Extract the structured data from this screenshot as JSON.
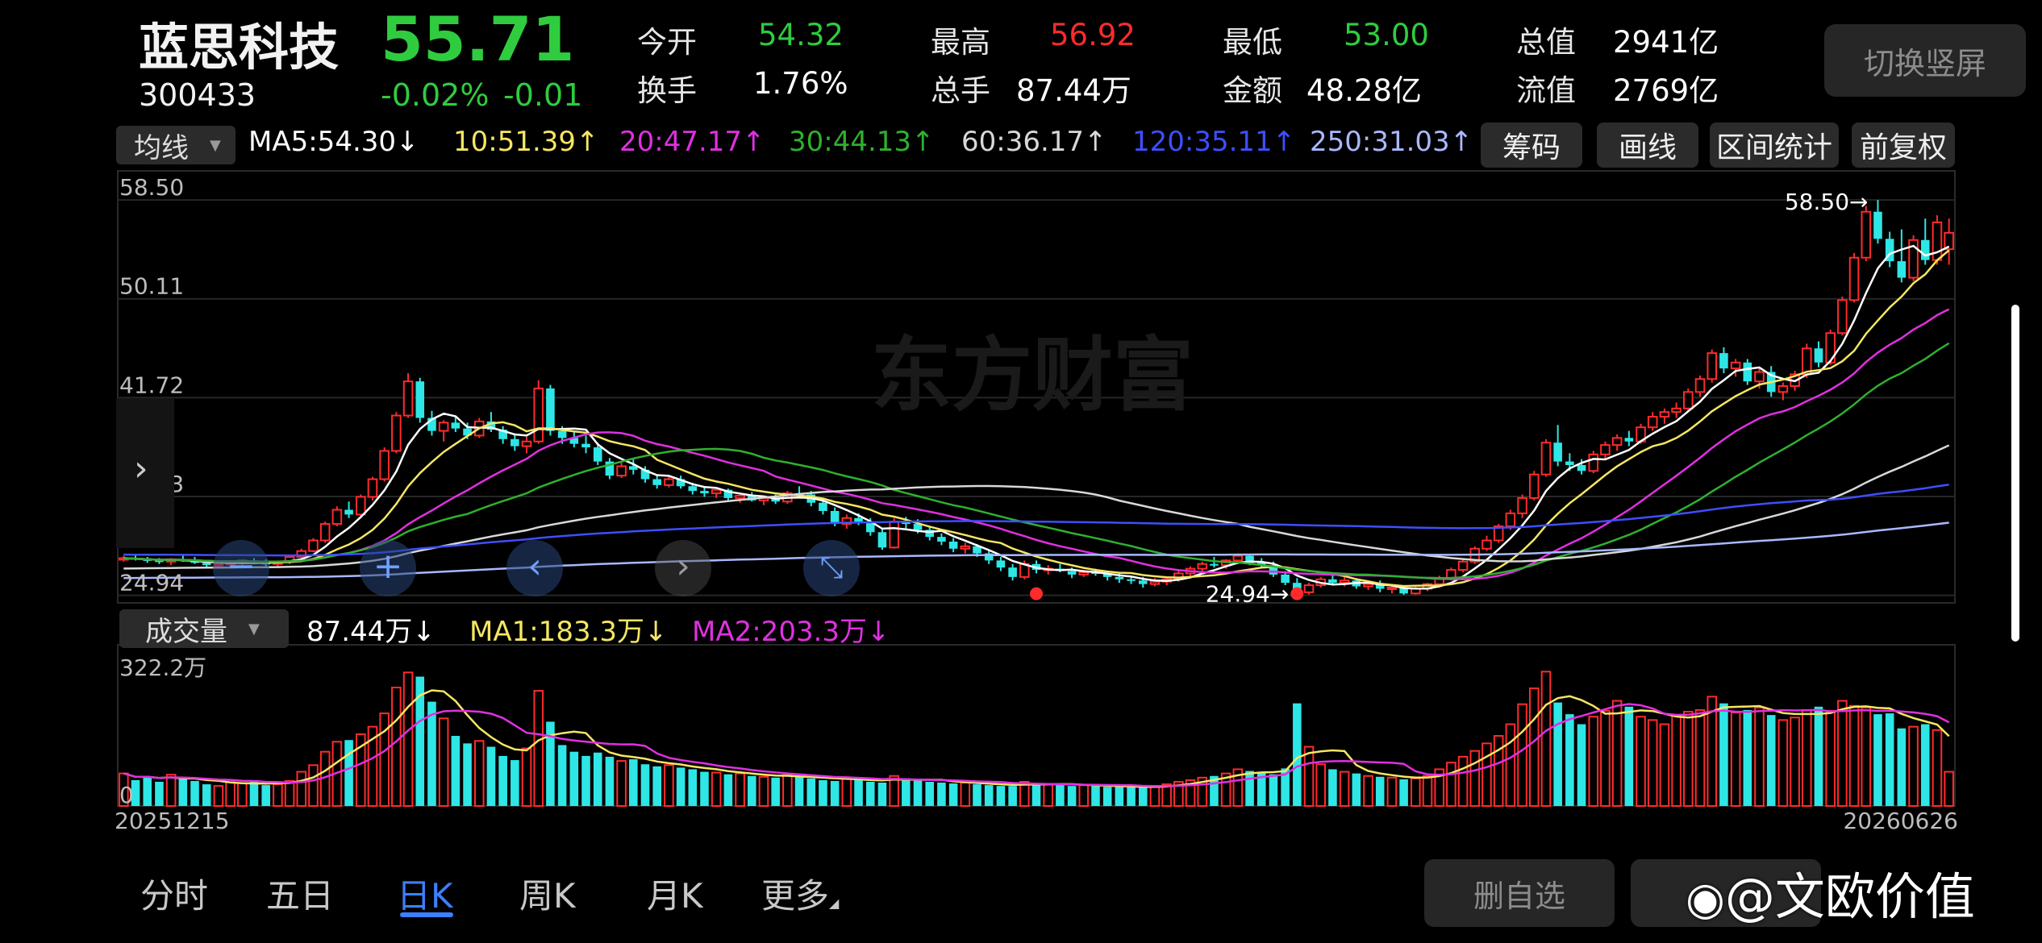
{
  "header": {
    "name": "蓝思科技",
    "code": "300433",
    "price": "55.71",
    "change_pct": "-0.02%",
    "change": "-0.01"
  },
  "quotes": [
    {
      "label": "今开",
      "value": "54.32",
      "color": "#2fcc3f"
    },
    {
      "label": "最高",
      "value": "56.92",
      "color": "#ff2b2b"
    },
    {
      "label": "最低",
      "value": "53.00",
      "color": "#2fcc3f"
    },
    {
      "label": "总值",
      "value": "2941亿",
      "color": "#ffffff"
    },
    {
      "label": "换手",
      "value": "1.76%",
      "color": "#ffffff"
    },
    {
      "label": "总手",
      "value": "87.44万",
      "color": "#ffffff"
    },
    {
      "label": "金额",
      "value": "48.28亿",
      "color": "#ffffff"
    },
    {
      "label": "流值",
      "value": "2769亿",
      "color": "#ffffff"
    }
  ],
  "orientation_button": "切换竖屏",
  "ma_bar": {
    "dropdown": "均线",
    "items": [
      {
        "text": "MA5:54.30",
        "arrow": "↓",
        "color": "#ffffff"
      },
      {
        "text": "10:51.39",
        "arrow": "↑",
        "color": "#f5e663"
      },
      {
        "text": "20:47.17",
        "arrow": "↑",
        "color": "#e030e0"
      },
      {
        "text": "30:44.13",
        "arrow": "↑",
        "color": "#2fb02f"
      },
      {
        "text": "60:36.17",
        "arrow": "↑",
        "color": "#d8d8d8"
      },
      {
        "text": "120:35.11",
        "arrow": "↑",
        "color": "#3d4fff"
      },
      {
        "text": "250:31.03",
        "arrow": "↑",
        "color": "#aab8ff"
      }
    ],
    "buttons": [
      "筹码",
      "画线",
      "区间统计",
      "前复权"
    ]
  },
  "volume_bar": {
    "dropdown": "成交量",
    "items": [
      {
        "text": "87.44万",
        "arrow": "↓",
        "color": "#ffffff"
      },
      {
        "text": "MA1:183.3万",
        "arrow": "↓",
        "color": "#f5e663"
      },
      {
        "text": "MA2:203.3万",
        "arrow": "↓",
        "color": "#e030e0"
      }
    ]
  },
  "chart_data": [
    {
      "type": "candlestick",
      "y_ticks": [
        "58.50",
        "50.11",
        "41.72",
        "33.33",
        "24.94"
      ],
      "ylim": [
        24.94,
        58.5
      ],
      "max_marker": "58.50→",
      "min_marker": "24.94→",
      "watermark": "东方财富",
      "up_color": "#ff2b2b",
      "down_color": "#2ee6e6",
      "x_start": "20251215",
      "x_end": "20260626",
      "ohlc": [
        [
          28.0,
          28.3,
          27.8,
          28.1
        ],
        [
          28.1,
          28.4,
          27.9,
          28.0
        ],
        [
          28.0,
          28.2,
          27.7,
          27.9
        ],
        [
          27.9,
          28.1,
          27.6,
          27.8
        ],
        [
          27.8,
          28.1,
          27.5,
          28.0
        ],
        [
          28.0,
          28.3,
          27.8,
          27.9
        ],
        [
          27.9,
          28.2,
          27.6,
          27.7
        ],
        [
          27.7,
          27.9,
          27.3,
          27.5
        ],
        [
          27.5,
          27.8,
          27.2,
          27.6
        ],
        [
          27.6,
          27.9,
          27.4,
          27.7
        ],
        [
          27.7,
          28.0,
          27.5,
          27.9
        ],
        [
          27.9,
          28.1,
          27.6,
          27.7
        ],
        [
          27.7,
          28.0,
          27.4,
          27.6
        ],
        [
          27.6,
          27.9,
          27.4,
          27.8
        ],
        [
          27.8,
          28.3,
          27.6,
          28.2
        ],
        [
          28.2,
          28.9,
          28.0,
          28.7
        ],
        [
          28.7,
          29.8,
          28.6,
          29.6
        ],
        [
          29.6,
          31.2,
          29.4,
          31.0
        ],
        [
          31.0,
          32.5,
          30.8,
          32.2
        ],
        [
          32.2,
          32.9,
          31.5,
          31.8
        ],
        [
          31.8,
          33.5,
          31.5,
          33.3
        ],
        [
          33.3,
          35.0,
          33.0,
          34.8
        ],
        [
          34.8,
          37.5,
          34.6,
          37.2
        ],
        [
          37.2,
          40.5,
          37.0,
          40.2
        ],
        [
          40.2,
          43.8,
          40.0,
          43.1
        ],
        [
          43.1,
          43.4,
          39.6,
          40.0
        ],
        [
          40.0,
          40.6,
          38.5,
          38.9
        ],
        [
          38.9,
          39.8,
          38.0,
          39.6
        ],
        [
          39.6,
          40.2,
          38.8,
          39.1
        ],
        [
          39.1,
          39.6,
          38.2,
          38.5
        ],
        [
          38.5,
          40.0,
          38.3,
          39.7
        ],
        [
          39.7,
          40.5,
          38.8,
          39.0
        ],
        [
          39.0,
          39.3,
          37.8,
          38.2
        ],
        [
          38.2,
          38.6,
          37.2,
          37.6
        ],
        [
          37.6,
          38.4,
          37.0,
          38.0
        ],
        [
          38.0,
          43.2,
          37.8,
          42.5
        ],
        [
          42.5,
          42.8,
          38.5,
          38.9
        ],
        [
          38.9,
          39.3,
          37.8,
          38.3
        ],
        [
          38.3,
          38.8,
          37.5,
          37.8
        ],
        [
          37.8,
          38.5,
          37.0,
          37.5
        ],
        [
          37.5,
          37.9,
          36.0,
          36.3
        ],
        [
          36.3,
          36.6,
          34.8,
          35.1
        ],
        [
          35.1,
          36.2,
          34.9,
          35.9
        ],
        [
          35.9,
          36.5,
          35.2,
          35.6
        ],
        [
          35.6,
          35.9,
          34.5,
          34.8
        ],
        [
          34.8,
          35.2,
          34.0,
          34.3
        ],
        [
          34.3,
          35.0,
          34.1,
          34.8
        ],
        [
          34.8,
          35.1,
          34.0,
          34.2
        ],
        [
          34.2,
          34.5,
          33.5,
          33.8
        ],
        [
          33.8,
          34.2,
          33.3,
          33.6
        ],
        [
          33.6,
          34.1,
          33.2,
          33.9
        ],
        [
          33.9,
          34.0,
          33.0,
          33.2
        ],
        [
          33.2,
          33.6,
          32.8,
          33.4
        ],
        [
          33.4,
          33.7,
          32.9,
          33.0
        ],
        [
          33.0,
          33.4,
          32.6,
          33.2
        ],
        [
          33.2,
          33.5,
          32.7,
          32.9
        ],
        [
          32.9,
          33.8,
          32.7,
          33.6
        ],
        [
          33.6,
          34.2,
          33.2,
          33.5
        ],
        [
          33.5,
          33.8,
          32.5,
          32.8
        ],
        [
          32.8,
          33.1,
          31.8,
          32.1
        ],
        [
          32.1,
          32.4,
          30.8,
          31.0
        ],
        [
          31.0,
          31.8,
          30.6,
          31.5
        ],
        [
          31.5,
          31.9,
          30.9,
          31.2
        ],
        [
          31.2,
          31.5,
          30.0,
          30.3
        ],
        [
          30.3,
          30.6,
          28.8,
          29.0
        ],
        [
          29.0,
          31.5,
          28.9,
          31.2
        ],
        [
          31.2,
          31.6,
          30.6,
          31.0
        ],
        [
          31.0,
          31.4,
          30.2,
          30.5
        ],
        [
          30.5,
          30.8,
          29.6,
          29.9
        ],
        [
          29.9,
          30.2,
          29.2,
          29.5
        ],
        [
          29.5,
          29.8,
          28.6,
          28.9
        ],
        [
          28.9,
          29.4,
          28.5,
          29.1
        ],
        [
          29.1,
          29.3,
          28.2,
          28.5
        ],
        [
          28.5,
          28.8,
          27.6,
          27.9
        ],
        [
          27.9,
          28.2,
          27.0,
          27.3
        ],
        [
          27.3,
          27.6,
          26.2,
          26.5
        ],
        [
          26.5,
          27.9,
          26.3,
          27.6
        ],
        [
          27.6,
          27.9,
          26.8,
          27.1
        ],
        [
          27.1,
          27.5,
          26.7,
          27.2
        ],
        [
          27.2,
          27.6,
          26.9,
          27.0
        ],
        [
          27.0,
          27.3,
          26.4,
          26.7
        ],
        [
          26.7,
          27.1,
          26.5,
          26.9
        ],
        [
          26.9,
          27.2,
          26.6,
          26.8
        ],
        [
          26.8,
          27.0,
          26.2,
          26.5
        ],
        [
          26.5,
          26.8,
          26.0,
          26.3
        ],
        [
          26.3,
          26.6,
          25.9,
          26.2
        ],
        [
          26.2,
          26.5,
          25.6,
          25.9
        ],
        [
          25.9,
          26.4,
          25.7,
          26.1
        ],
        [
          26.1,
          26.5,
          25.8,
          26.3
        ],
        [
          26.3,
          27.0,
          26.1,
          26.8
        ],
        [
          26.8,
          27.4,
          26.6,
          27.2
        ],
        [
          27.2,
          27.8,
          27.0,
          27.6
        ],
        [
          27.6,
          28.2,
          27.3,
          27.5
        ],
        [
          27.5,
          28.0,
          27.2,
          27.9
        ],
        [
          27.9,
          28.5,
          27.6,
          28.3
        ],
        [
          28.3,
          28.4,
          27.5,
          27.7
        ],
        [
          27.7,
          28.1,
          27.3,
          27.5
        ],
        [
          27.5,
          27.8,
          26.5,
          26.7
        ],
        [
          26.7,
          27.0,
          25.8,
          26.0
        ],
        [
          26.0,
          26.4,
          24.94,
          25.2
        ],
        [
          25.2,
          26.0,
          25.0,
          25.8
        ],
        [
          25.8,
          26.5,
          25.6,
          26.3
        ],
        [
          26.3,
          26.7,
          25.8,
          26.0
        ],
        [
          26.0,
          26.5,
          25.7,
          26.2
        ],
        [
          26.2,
          26.4,
          25.5,
          25.7
        ],
        [
          25.7,
          26.1,
          25.4,
          25.9
        ],
        [
          25.9,
          26.2,
          25.2,
          25.5
        ],
        [
          25.5,
          25.9,
          25.1,
          25.6
        ],
        [
          25.6,
          25.8,
          24.98,
          25.1
        ],
        [
          25.1,
          25.7,
          25.0,
          25.5
        ],
        [
          25.5,
          26.0,
          25.3,
          25.9
        ],
        [
          25.9,
          26.6,
          25.7,
          26.4
        ],
        [
          26.4,
          27.3,
          26.2,
          27.1
        ],
        [
          27.1,
          28.0,
          26.9,
          27.8
        ],
        [
          27.8,
          29.1,
          27.6,
          28.9
        ],
        [
          28.9,
          30.0,
          28.7,
          29.6
        ],
        [
          29.6,
          31.0,
          29.4,
          30.8
        ],
        [
          30.8,
          32.2,
          30.5,
          31.9
        ],
        [
          31.9,
          33.5,
          31.5,
          33.2
        ],
        [
          33.2,
          35.5,
          33.0,
          35.2
        ],
        [
          35.2,
          38.2,
          35.0,
          37.9
        ],
        [
          37.9,
          39.4,
          35.9,
          36.3
        ],
        [
          36.3,
          37.0,
          35.5,
          36.0
        ],
        [
          36.0,
          36.5,
          35.2,
          35.5
        ],
        [
          35.5,
          37.2,
          35.3,
          36.9
        ],
        [
          36.9,
          38.0,
          36.5,
          37.7
        ],
        [
          37.7,
          38.6,
          37.2,
          38.3
        ],
        [
          38.3,
          38.9,
          37.6,
          38.0
        ],
        [
          38.0,
          39.5,
          37.8,
          39.2
        ],
        [
          39.2,
          40.5,
          38.9,
          40.1
        ],
        [
          40.1,
          40.8,
          39.5,
          40.5
        ],
        [
          40.5,
          41.3,
          40.0,
          40.8
        ],
        [
          40.8,
          42.5,
          40.5,
          42.2
        ],
        [
          42.2,
          43.6,
          41.8,
          43.3
        ],
        [
          43.3,
          45.8,
          43.0,
          45.5
        ],
        [
          45.5,
          46.0,
          43.8,
          44.2
        ],
        [
          44.2,
          45.0,
          43.5,
          44.7
        ],
        [
          44.7,
          45.0,
          42.8,
          43.1
        ],
        [
          43.1,
          44.2,
          42.5,
          43.9
        ],
        [
          43.9,
          44.4,
          41.8,
          42.2
        ],
        [
          42.2,
          43.0,
          41.5,
          42.7
        ],
        [
          42.7,
          44.0,
          42.3,
          43.7
        ],
        [
          43.7,
          46.3,
          43.4,
          45.9
        ],
        [
          45.9,
          46.5,
          44.3,
          44.7
        ],
        [
          44.7,
          47.5,
          44.5,
          47.2
        ],
        [
          47.2,
          50.3,
          47.0,
          50.0
        ],
        [
          50.0,
          54.0,
          49.8,
          53.6
        ],
        [
          53.6,
          58.0,
          53.3,
          57.5
        ],
        [
          57.5,
          58.5,
          54.8,
          55.2
        ],
        [
          55.2,
          55.8,
          52.8,
          53.3
        ],
        [
          53.3,
          56.0,
          51.5,
          51.9
        ],
        [
          51.9,
          55.5,
          51.6,
          55.1
        ],
        [
          55.1,
          56.92,
          53.0,
          53.4
        ],
        [
          53.4,
          57.2,
          53.0,
          56.6
        ],
        [
          54.32,
          56.92,
          53.0,
          55.71
        ]
      ]
    },
    {
      "type": "bar",
      "y_ticks": [
        "322.2万",
        "0"
      ],
      "ylim": [
        0,
        322.2
      ],
      "unit": "万",
      "x_start": "20251215",
      "x_end": "20260626",
      "volume": [
        78,
        62,
        70,
        58,
        75,
        66,
        60,
        52,
        48,
        57,
        55,
        58,
        50,
        52,
        60,
        82,
        98,
        130,
        154,
        158,
        172,
        190,
        222,
        284,
        320,
        310,
        250,
        210,
        168,
        150,
        156,
        142,
        120,
        110,
        138,
        276,
        202,
        146,
        130,
        120,
        128,
        118,
        108,
        112,
        100,
        95,
        98,
        92,
        88,
        82,
        80,
        76,
        78,
        72,
        70,
        68,
        74,
        70,
        66,
        62,
        60,
        68,
        64,
        58,
        56,
        72,
        66,
        62,
        58,
        56,
        54,
        56,
        52,
        50,
        48,
        48,
        58,
        54,
        52,
        50,
        48,
        50,
        48,
        46,
        46,
        45,
        44,
        48,
        52,
        58,
        62,
        68,
        72,
        78,
        88,
        84,
        80,
        76,
        90,
        246,
        142,
        100,
        88,
        82,
        78,
        72,
        70,
        68,
        64,
        66,
        72,
        88,
        104,
        118,
        132,
        150,
        168,
        196,
        244,
        282,
        322,
        248,
        220,
        196,
        214,
        228,
        252,
        238,
        214,
        206,
        196,
        218,
        226,
        230,
        262,
        246,
        224,
        230,
        236,
        218,
        206,
        212,
        230,
        238,
        228,
        252,
        240,
        236,
        220,
        222,
        186,
        190,
        196,
        182,
        82
      ],
      "up_days": "see ohlc"
    }
  ],
  "period_tabs": [
    "分时",
    "五日",
    "日K",
    "周K",
    "月K",
    "更多"
  ],
  "selected_tab": "日K",
  "bottom_buttons": {
    "remove_watchlist": "删自选"
  },
  "overlay_watermark": "@文欧价值"
}
